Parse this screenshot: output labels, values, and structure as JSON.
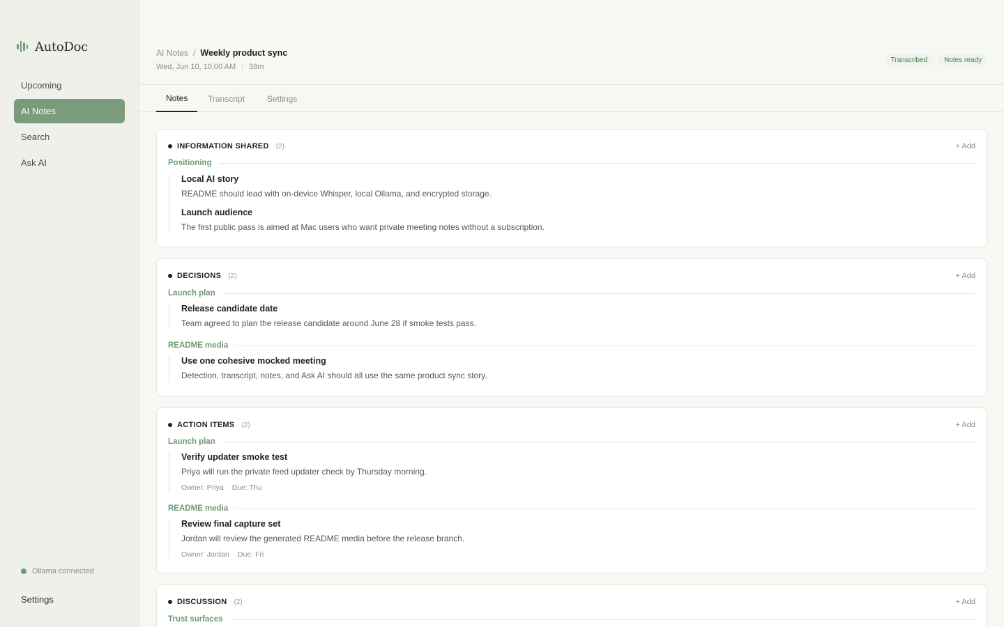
{
  "app": {
    "name": "AutoDoc"
  },
  "sidebar": {
    "items": [
      {
        "label": "Upcoming"
      },
      {
        "label": "AI Notes"
      },
      {
        "label": "Search"
      },
      {
        "label": "Ask AI"
      }
    ],
    "status": "Ollama connected",
    "settings_label": "Settings"
  },
  "header": {
    "breadcrumb_parent": "AI Notes",
    "breadcrumb_sep": "/",
    "title": "Weekly product sync",
    "date": "Wed, Jun 10, 10:00 AM",
    "duration": "38m",
    "badges": [
      "Transcribed",
      "Notes ready"
    ]
  },
  "tabs": [
    {
      "label": "Notes"
    },
    {
      "label": "Transcript"
    },
    {
      "label": "Settings"
    }
  ],
  "sections": [
    {
      "title": "INFORMATION SHARED",
      "count": "(2)",
      "add_label": "+ Add",
      "groups": [
        {
          "label": "Positioning",
          "items": [
            {
              "title": "Local AI story",
              "desc": "README should lead with on-device Whisper, local Ollama, and encrypted storage."
            },
            {
              "title": "Launch audience",
              "desc": "The first public pass is aimed at Mac users who want private meeting notes without a subscription."
            }
          ]
        }
      ]
    },
    {
      "title": "DECISIONS",
      "count": "(2)",
      "add_label": "+ Add",
      "groups": [
        {
          "label": "Launch plan",
          "items": [
            {
              "title": "Release candidate date",
              "desc": "Team agreed to plan the release candidate around June 28 if smoke tests pass."
            }
          ]
        },
        {
          "label": "README media",
          "items": [
            {
              "title": "Use one cohesive mocked meeting",
              "desc": "Detection, transcript, notes, and Ask AI should all use the same product sync story."
            }
          ]
        }
      ]
    },
    {
      "title": "ACTION ITEMS",
      "count": "(2)",
      "add_label": "+ Add",
      "groups": [
        {
          "label": "Launch plan",
          "items": [
            {
              "title": "Verify updater smoke test",
              "desc": "Priya will run the private feed updater check by Thursday morning.",
              "owner": "Owner: Priya",
              "due": "Due: Thu"
            }
          ]
        },
        {
          "label": "README media",
          "items": [
            {
              "title": "Review final capture set",
              "desc": "Jordan will review the generated README media before the release branch.",
              "owner": "Owner: Jordan",
              "due": "Due: Fri"
            }
          ]
        }
      ]
    },
    {
      "title": "DISCUSSION",
      "count": "(2)",
      "add_label": "+ Add",
      "groups": [
        {
          "label": "Trust surfaces",
          "items": []
        }
      ]
    }
  ]
}
